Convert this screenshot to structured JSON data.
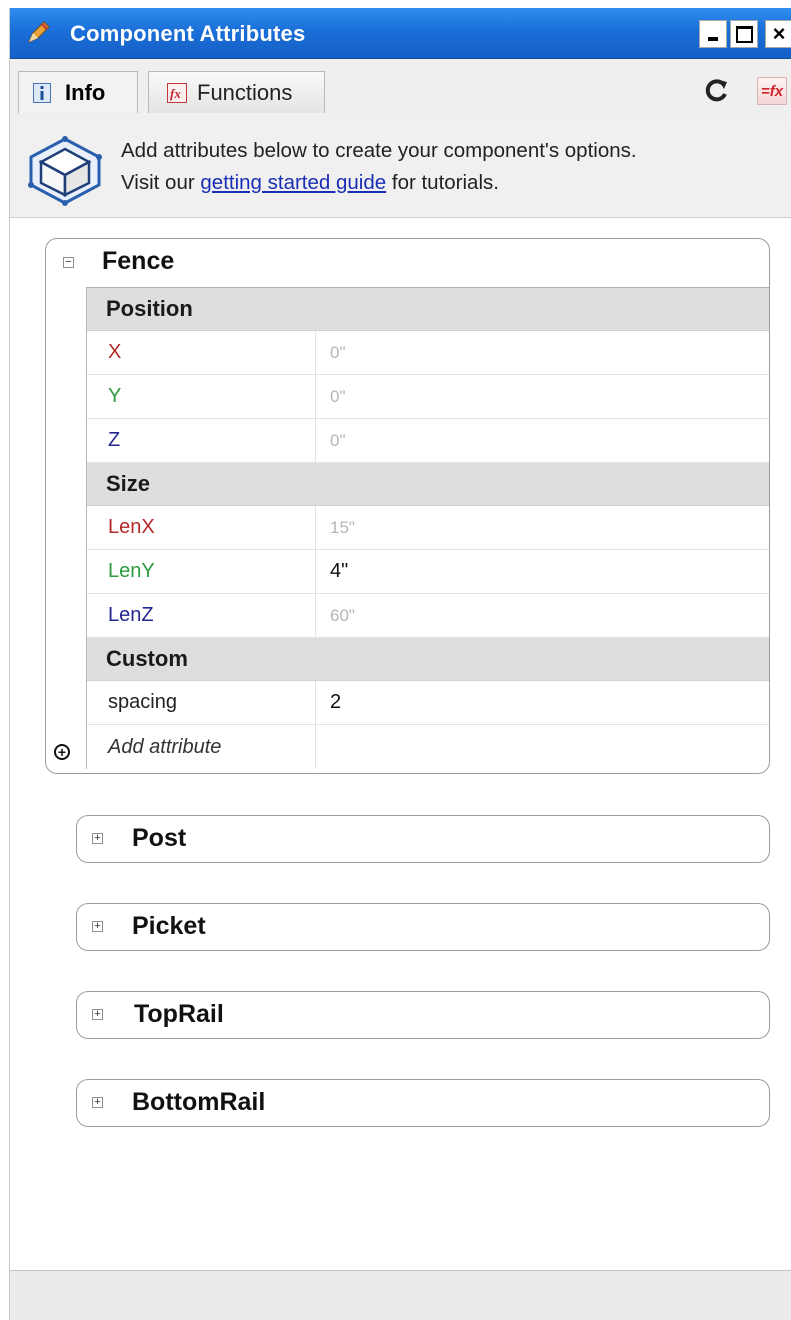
{
  "window": {
    "title": "Component Attributes",
    "minimize": "-",
    "close": "×"
  },
  "tabs": [
    {
      "label": "Info",
      "icon": "info-icon",
      "active": true
    },
    {
      "label": "Functions",
      "icon": "functions-icon",
      "active": false
    }
  ],
  "toolbar": {
    "refresh_icon": "refresh-icon",
    "fx_label": "=fx"
  },
  "banner": {
    "line1": "Add attributes below to create your component's options.",
    "line2_prefix": "Visit our ",
    "link_text": "getting started guide",
    "line2_suffix": " for tutorials."
  },
  "panels": {
    "fence": {
      "title": "Fence",
      "expanded": true,
      "toggle": "⊟",
      "sections": {
        "position": {
          "label": "Position",
          "rows": [
            {
              "name": "X",
              "value": "0\"",
              "color": "#b22a2a"
            },
            {
              "name": "Y",
              "value": "0\"",
              "color": "#2e9a3e"
            },
            {
              "name": "Z",
              "value": "0\"",
              "color": "#24278f"
            }
          ]
        },
        "size": {
          "label": "Size",
          "rows": [
            {
              "name": "LenX",
              "value": "15\"",
              "color": "#b22a2a"
            },
            {
              "name": "LenY",
              "value": "4\"",
              "color": "#2e9a3e"
            },
            {
              "name": "LenZ",
              "value": "60\"",
              "color": "#24278f"
            }
          ]
        },
        "custom": {
          "label": "Custom",
          "rows": [
            {
              "name": "spacing",
              "value": "2",
              "color": "#222222"
            }
          ]
        }
      },
      "add_label": "Add attribute"
    },
    "post": {
      "title": "Post",
      "expanded": false
    },
    "picket": {
      "title": "Picket",
      "expanded": false
    },
    "toprail": {
      "title": "TopRail",
      "expanded": false
    },
    "bottomrail": {
      "title": "BottomRail",
      "expanded": false
    }
  },
  "colors": {
    "titlebar": "#1a6fd8",
    "link": "#1a2fb5",
    "section_bg": "#dedede"
  }
}
